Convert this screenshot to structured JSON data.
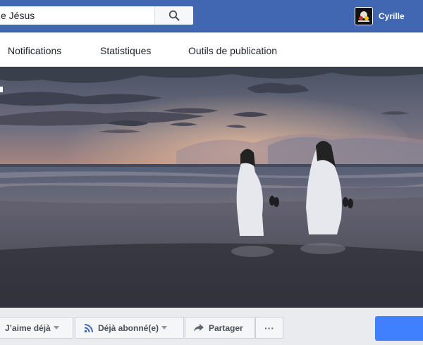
{
  "search": {
    "value": "e Jésus"
  },
  "user": {
    "name": "Cyrille"
  },
  "tabs": [
    {
      "label": "Notifications"
    },
    {
      "label": "Statistiques"
    },
    {
      "label": "Outils de publication"
    }
  ],
  "actions": {
    "like_label": "J’aime déjà",
    "follow_label": "Déjà abonné(e)",
    "share_label": "Partager",
    "more_label": "···"
  },
  "colors": {
    "topbar": "#4267b2",
    "primary_button": "#4080ff"
  },
  "icons": [
    "search-icon",
    "rss-icon",
    "share-arrow-icon",
    "caret-down-icon"
  ]
}
